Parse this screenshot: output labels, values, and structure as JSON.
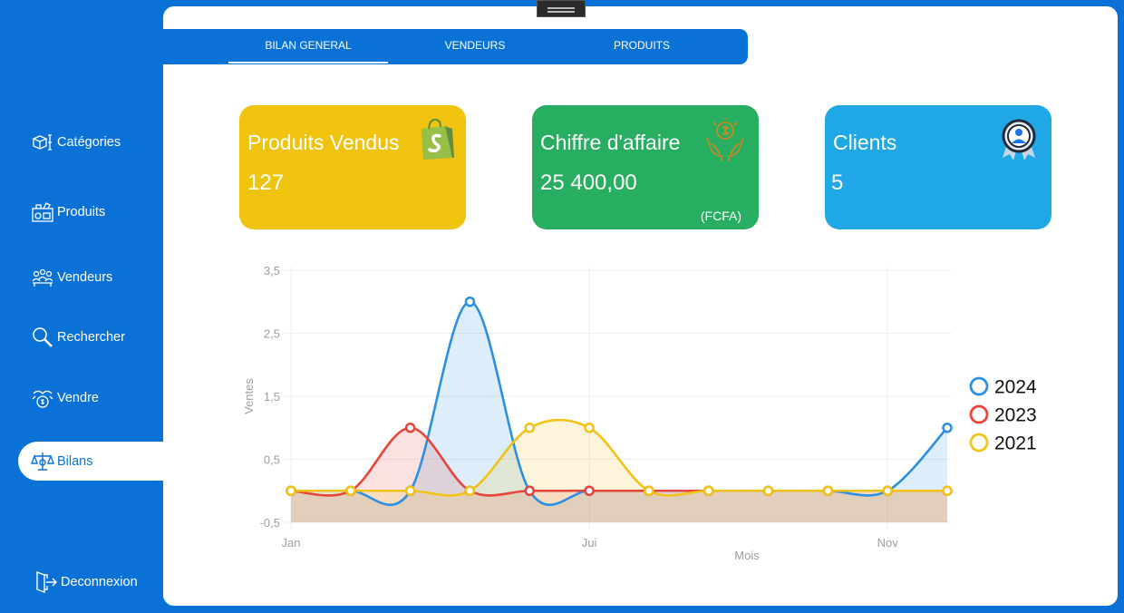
{
  "tabs": [
    {
      "label": "BILAN GENERAL",
      "active": true
    },
    {
      "label": "VENDEURS",
      "active": false
    },
    {
      "label": "PRODUITS",
      "active": false
    }
  ],
  "sidebar": {
    "items": [
      {
        "label": "Catégories",
        "icon": "categories-icon"
      },
      {
        "label": "Produits",
        "icon": "products-icon"
      },
      {
        "label": "Vendeurs",
        "icon": "sellers-icon"
      },
      {
        "label": "Rechercher",
        "icon": "search-icon"
      },
      {
        "label": "Vendre",
        "icon": "sell-icon"
      },
      {
        "label": "Bilans",
        "icon": "balance-icon",
        "active": true
      }
    ],
    "logout_label": "Deconnexion"
  },
  "cards": {
    "products": {
      "title": "Produits Vendus",
      "value": "127",
      "color": "#f0c30f",
      "icon": "shopping-bag-icon"
    },
    "revenue": {
      "title": "Chiffre d'affaire",
      "value": "25 400,00",
      "unit": "(FCFA)",
      "color": "#27ae60",
      "icon": "money-hands-icon"
    },
    "clients": {
      "title": "Clients",
      "value": "5",
      "color": "#1fa8e5",
      "icon": "client-badge-icon"
    }
  },
  "chart_data": {
    "type": "area",
    "xlabel": "Mois",
    "ylabel": "Ventes",
    "ylim": [
      -0.5,
      3.5
    ],
    "yticks": [
      "-0,5",
      "0,5",
      "1,5",
      "2,5",
      "3,5"
    ],
    "x_tick_labels": [
      "Jan",
      "Jui",
      "Nov"
    ],
    "legend_position": "right",
    "smooth": true,
    "grid": true,
    "series": [
      {
        "name": "2024",
        "color": "#2b8fe3",
        "values": [
          0,
          0,
          0,
          3,
          0,
          0,
          0,
          0,
          0,
          0,
          0,
          1
        ]
      },
      {
        "name": "2023",
        "color": "#e8443a",
        "values": [
          0,
          0,
          1,
          0,
          0,
          0,
          0,
          0,
          0,
          0,
          0,
          0
        ]
      },
      {
        "name": "2021",
        "color": "#f2c217",
        "values": [
          0,
          0,
          0,
          0,
          1,
          1,
          0,
          0,
          0,
          0,
          0,
          0
        ]
      }
    ]
  }
}
